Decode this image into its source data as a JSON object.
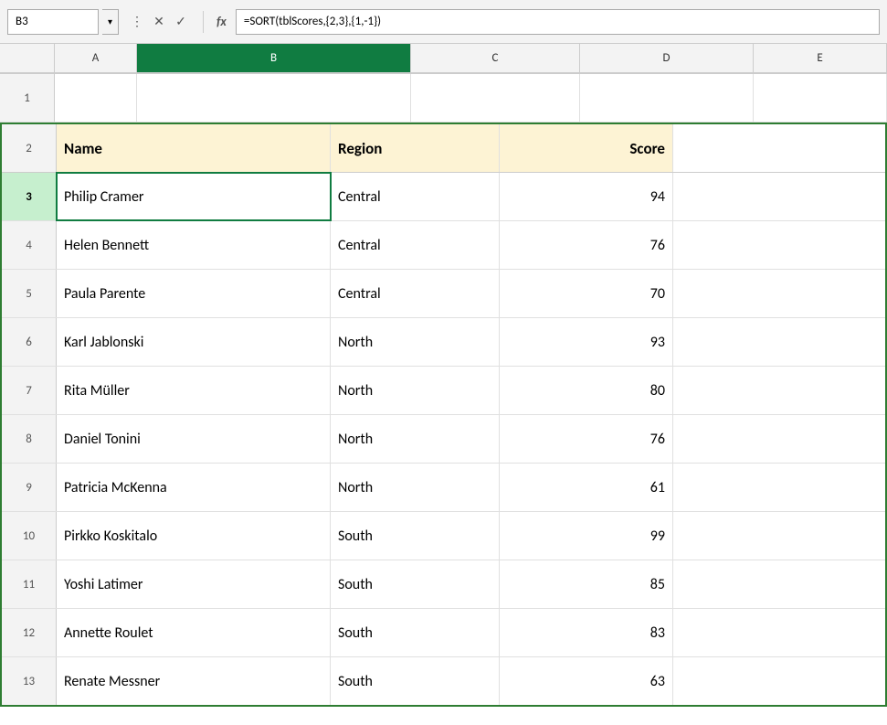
{
  "formulaBar": {
    "cellRef": "B3",
    "formula": "=SORT(tblScores,{2,3},{1,-1})",
    "fxLabel": "fx"
  },
  "columns": {
    "headers": [
      "A",
      "B",
      "C",
      "D",
      "E"
    ],
    "selectedCol": "B"
  },
  "rows": [
    {
      "num": "1",
      "data": [
        "",
        "",
        "",
        ""
      ]
    },
    {
      "num": "2",
      "isHeader": true,
      "data": [
        "Name",
        "Region",
        "Score",
        ""
      ]
    },
    {
      "num": "3",
      "selected": true,
      "data": [
        "Philip Cramer",
        "Central",
        "94",
        ""
      ]
    },
    {
      "num": "4",
      "data": [
        "Helen Bennett",
        "Central",
        "76",
        ""
      ]
    },
    {
      "num": "5",
      "data": [
        "Paula Parente",
        "Central",
        "70",
        ""
      ]
    },
    {
      "num": "6",
      "data": [
        "Karl Jablonski",
        "North",
        "93",
        ""
      ]
    },
    {
      "num": "7",
      "data": [
        "Rita Müller",
        "North",
        "80",
        ""
      ]
    },
    {
      "num": "8",
      "data": [
        "Daniel Tonini",
        "North",
        "76",
        ""
      ]
    },
    {
      "num": "9",
      "data": [
        "Patricia McKenna",
        "North",
        "61",
        ""
      ]
    },
    {
      "num": "10",
      "data": [
        "Pirkko Koskitalo",
        "South",
        "99",
        ""
      ]
    },
    {
      "num": "11",
      "data": [
        "Yoshi Latimer",
        "South",
        "85",
        ""
      ]
    },
    {
      "num": "12",
      "data": [
        "Annette Roulet",
        "South",
        "83",
        ""
      ]
    },
    {
      "num": "13",
      "data": [
        "Renate Messner",
        "South",
        "63",
        ""
      ]
    }
  ]
}
